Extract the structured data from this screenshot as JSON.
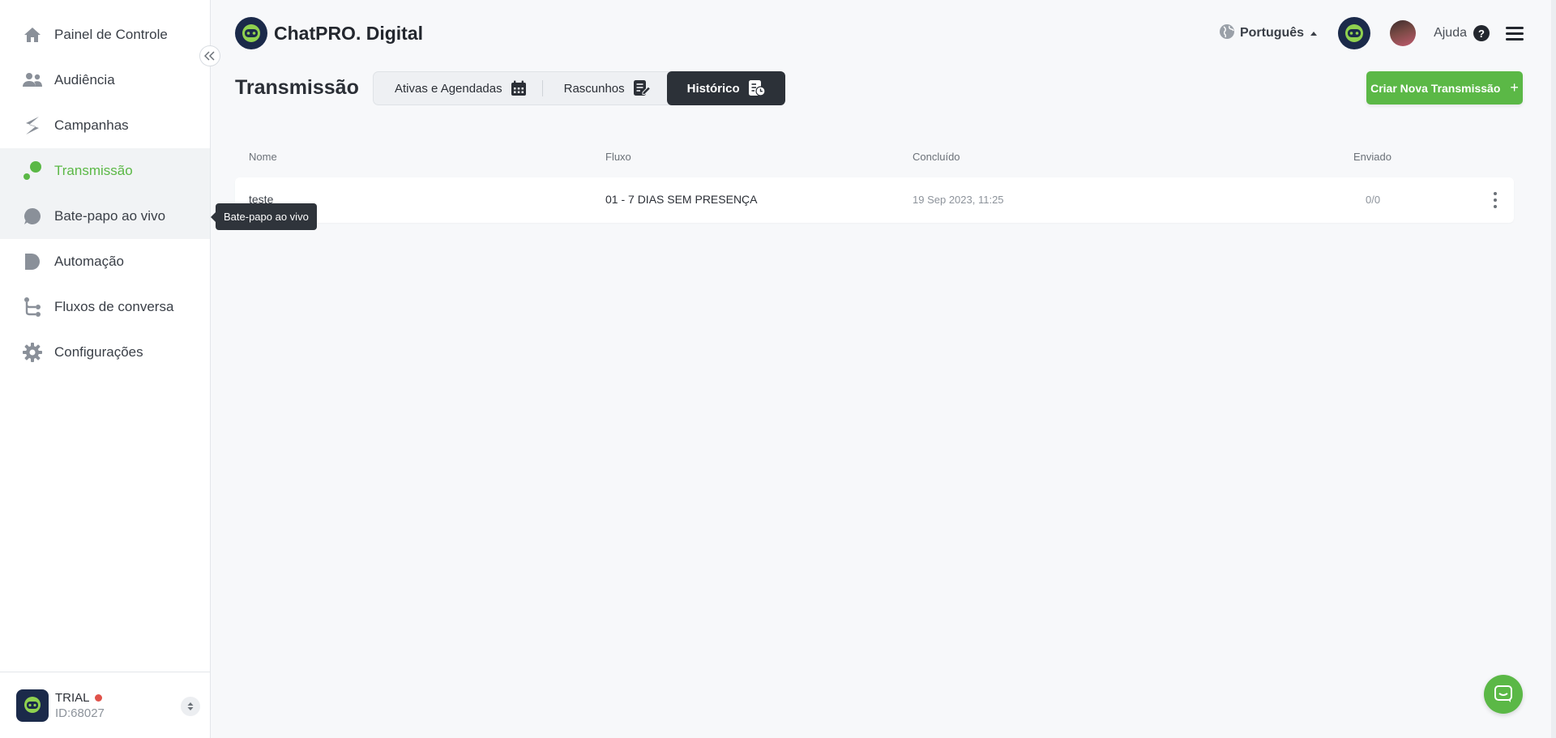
{
  "sidebar": {
    "items": [
      {
        "label": "Painel de Controle",
        "icon": "home-icon"
      },
      {
        "label": "Audiência",
        "icon": "users-icon"
      },
      {
        "label": "Campanhas",
        "icon": "campaign-icon"
      },
      {
        "label": "Transmissão",
        "icon": "broadcast-icon",
        "active": true
      },
      {
        "label": "Bate-papo ao vivo",
        "icon": "chat-bubble-icon"
      },
      {
        "label": "Automação",
        "icon": "automation-icon"
      },
      {
        "label": "Fluxos de conversa",
        "icon": "flow-icon"
      },
      {
        "label": "Configurações",
        "icon": "gear-icon"
      }
    ],
    "tooltip": "Bate-papo ao vivo",
    "account": {
      "plan": "TRIAL",
      "id": "ID:68027"
    }
  },
  "header": {
    "brand": "ChatPRO. Digital",
    "language": "Português",
    "help": "Ajuda"
  },
  "page": {
    "title": "Transmissão",
    "tabs": [
      {
        "label": "Ativas e Agendadas",
        "icon": "calendar-icon"
      },
      {
        "label": "Rascunhos",
        "icon": "draft-icon"
      },
      {
        "label": "Histórico",
        "icon": "history-icon",
        "active": true
      }
    ],
    "new_button": "Criar Nova Transmissão"
  },
  "table": {
    "columns": [
      "Nome",
      "Fluxo",
      "Concluído",
      "Enviado"
    ],
    "rows": [
      {
        "name": "teste",
        "flow": "01 - 7 DIAS SEM PRESENÇA",
        "completed": "19 Sep 2023, 11:25",
        "sent": "0/0"
      }
    ]
  },
  "colors": {
    "accent": "#5bb846",
    "dark": "#2c3138",
    "status_dot": "#e0524a"
  }
}
